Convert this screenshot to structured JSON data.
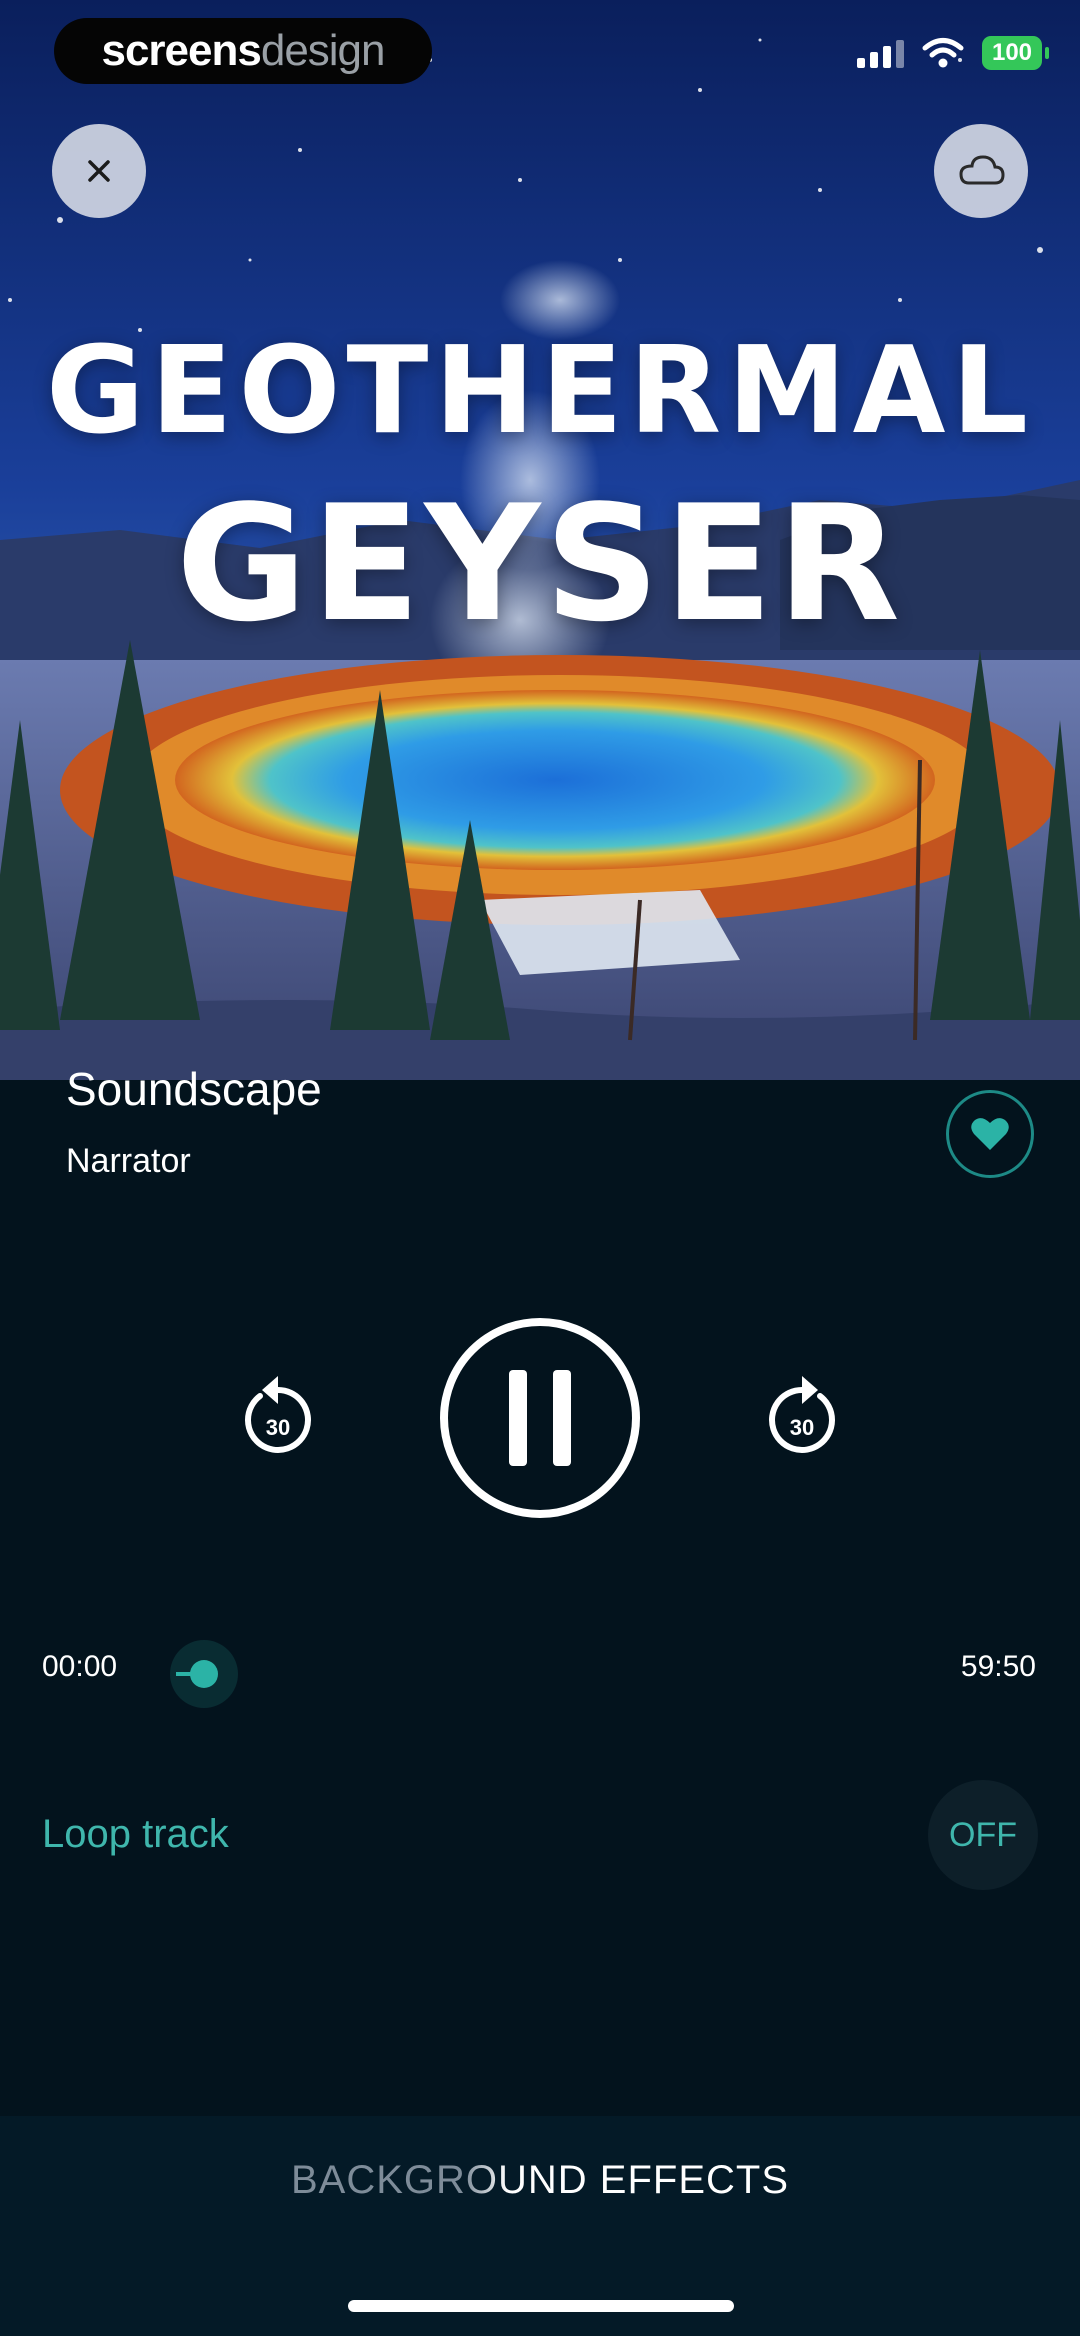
{
  "branding": {
    "part1": "screens",
    "part2": "design"
  },
  "status_bar": {
    "battery": "100"
  },
  "hero": {
    "title_line1": "GEOTHERMAL",
    "title_line2": "GEYSER"
  },
  "track": {
    "title": "Soundscape",
    "narrator": "Narrator"
  },
  "player": {
    "rewind_seconds": "30",
    "forward_seconds": "30",
    "elapsed": "00:00",
    "duration": "59:50",
    "progress_fraction": 0.0
  },
  "loop": {
    "label": "Loop track",
    "state": "OFF"
  },
  "footer": {
    "background_effects_label": "BACKGROUND EFFECTS"
  },
  "colors": {
    "accent": "#2bb3a6",
    "background": "#03131d",
    "battery": "#34c759"
  },
  "icons": [
    "close-icon",
    "cloud-icon",
    "heart-icon",
    "rewind-30-icon",
    "pause-icon",
    "forward-30-icon"
  ]
}
